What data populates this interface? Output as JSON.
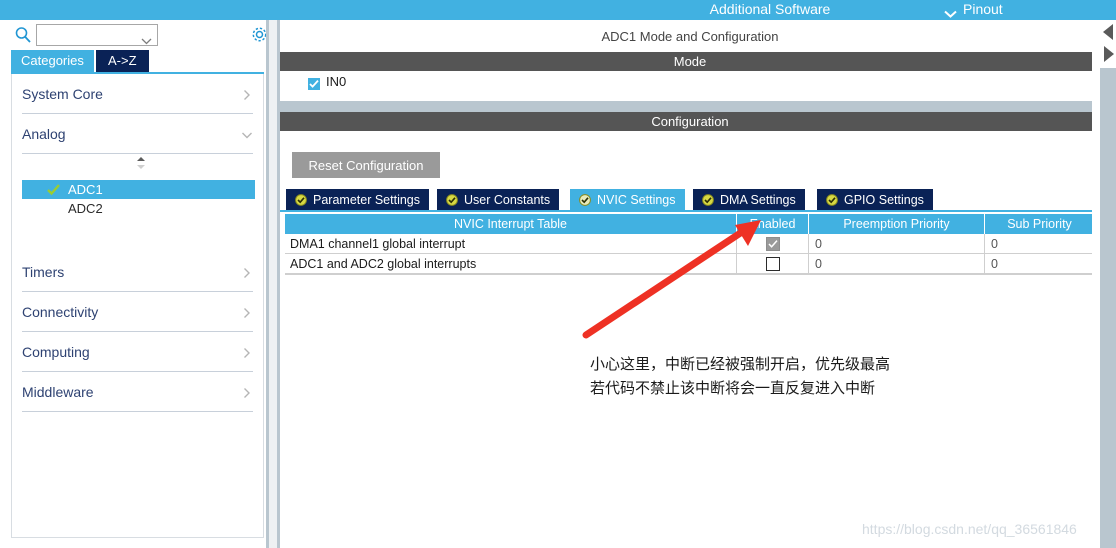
{
  "topbar": {
    "additional_software": "Additional Software",
    "pinout": "Pinout",
    "chevron_icon": "chevron-down-icon",
    "bg_color": "#41b1e1"
  },
  "left_panel": {
    "search": {
      "value": "",
      "placeholder": "",
      "icon": "search-icon",
      "caret_icon": "chevron-down-icon"
    },
    "gear_icon": "gear-icon",
    "tabs": [
      {
        "label": "Categories",
        "active": true
      },
      {
        "label": "A->Z",
        "active": false
      }
    ],
    "categories": [
      {
        "label": "System Core",
        "expanded": false,
        "chevron": "chevron-right-icon"
      },
      {
        "label": "Analog",
        "expanded": true,
        "chevron": "chevron-down-icon"
      },
      {
        "label": "Timers",
        "expanded": false,
        "chevron": "chevron-right-icon"
      },
      {
        "label": "Connectivity",
        "expanded": false,
        "chevron": "chevron-right-icon"
      },
      {
        "label": "Computing",
        "expanded": false,
        "chevron": "chevron-right-icon"
      },
      {
        "label": "Middleware",
        "expanded": false,
        "chevron": "chevron-right-icon"
      }
    ],
    "analog_children": [
      {
        "label": "ADC1",
        "selected": true,
        "checked": true
      },
      {
        "label": "ADC2",
        "selected": false,
        "checked": false
      }
    ],
    "spinner_icon": "scroll-spinner-icon"
  },
  "content": {
    "title": "ADC1 Mode and Configuration",
    "mode_section": "Mode",
    "mode_items": [
      {
        "label": "IN0",
        "checked": true
      }
    ],
    "config_section": "Configuration",
    "reset_button": "Reset Configuration",
    "tabs": [
      {
        "label": "Parameter Settings",
        "active": false,
        "icon": "status-ok-icon"
      },
      {
        "label": "User Constants",
        "active": false,
        "icon": "status-ok-icon"
      },
      {
        "label": "NVIC Settings",
        "active": true,
        "icon": "status-ok-icon"
      },
      {
        "label": "DMA Settings",
        "active": false,
        "icon": "status-ok-icon"
      },
      {
        "label": "GPIO Settings",
        "active": false,
        "icon": "status-ok-icon"
      }
    ],
    "table": {
      "headers": [
        "NVIC Interrupt Table",
        "Enabled",
        "Preemption Priority",
        "Sub Priority"
      ],
      "rows": [
        {
          "name": "DMA1 channel1 global interrupt",
          "enabled": true,
          "enabled_disabled": true,
          "preemption": "0",
          "sub": "0"
        },
        {
          "name": "ADC1 and ADC2 global interrupts",
          "enabled": false,
          "enabled_disabled": false,
          "preemption": "0",
          "sub": "0"
        }
      ]
    }
  },
  "annotation": {
    "arrow_icon": "red-arrow-icon",
    "arrow_color": "#ee3124",
    "line1": "小心这里，中断已经被强制开启，优先级最高",
    "line2": "若代码不禁止该中断将会一直反复进入中断"
  },
  "watermark": {
    "text": "https://blog.csdn.net/qq_36561846"
  },
  "scrollbar": {
    "left_arrow_icon": "triangle-left-icon",
    "right_arrow_icon": "triangle-right-icon"
  }
}
